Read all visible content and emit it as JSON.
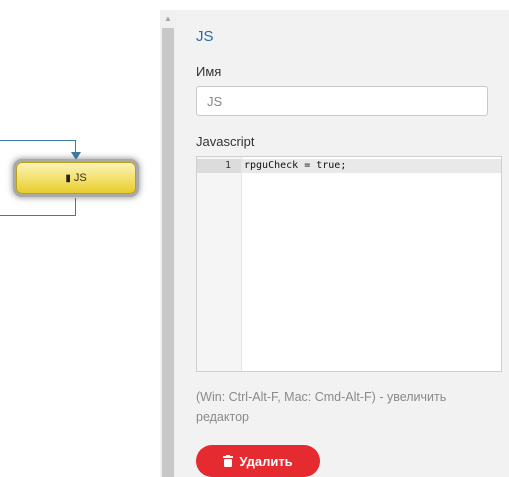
{
  "node": {
    "label": "JS",
    "icon": "book-icon"
  },
  "panel": {
    "title": "JS",
    "name_label": "Имя",
    "name_value": "JS",
    "js_label": "Javascript",
    "editor": {
      "line_number": "1",
      "code": "rpguCheck = true;"
    },
    "hint": "(Win: Ctrl-Alt-F, Mac: Cmd-Alt-F) - увеличить редактор",
    "delete_label": "Удалить"
  },
  "colors": {
    "accent": "#2c6aa0",
    "danger": "#e52b2f",
    "node_fill": "#f3e06a",
    "connector": "#3a7ca5"
  }
}
